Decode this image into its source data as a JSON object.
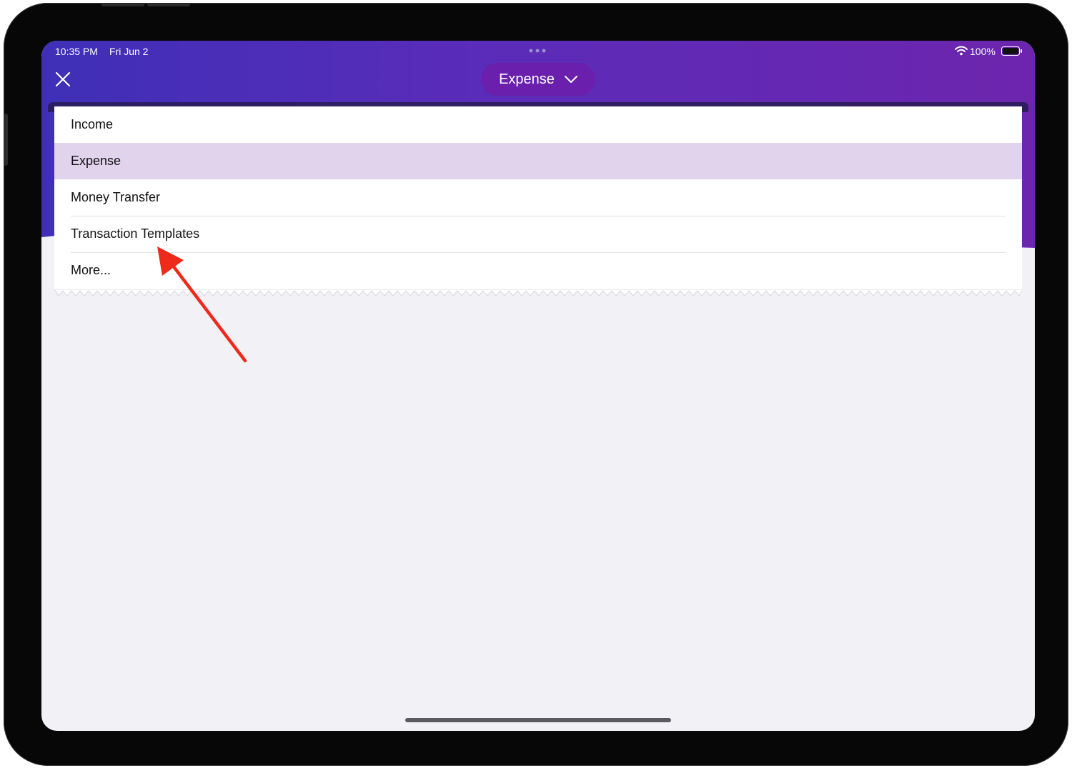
{
  "status_bar": {
    "time": "10:35 PM",
    "date": "Fri Jun 2",
    "battery": "100%",
    "wifi_icon": "wifi-icon",
    "battery_icon": "battery-full-icon"
  },
  "header": {
    "close_icon": "close-icon",
    "type_selector": {
      "label": "Expense",
      "icon": "chevron-down-icon"
    }
  },
  "menu": {
    "items": [
      {
        "label": "Income",
        "selected": false
      },
      {
        "label": "Expense",
        "selected": true
      },
      {
        "label": "Money Transfer",
        "selected": false
      },
      {
        "label": "Transaction Templates",
        "selected": false
      },
      {
        "label": "More...",
        "selected": false
      }
    ]
  },
  "colors": {
    "header_gradient_start": "#3f2fb7",
    "header_gradient_end": "#6d25ad",
    "selected_row": "#e1d3ec",
    "annotation_arrow": "#ee2a1b",
    "screen_background": "#f2f1f6"
  }
}
